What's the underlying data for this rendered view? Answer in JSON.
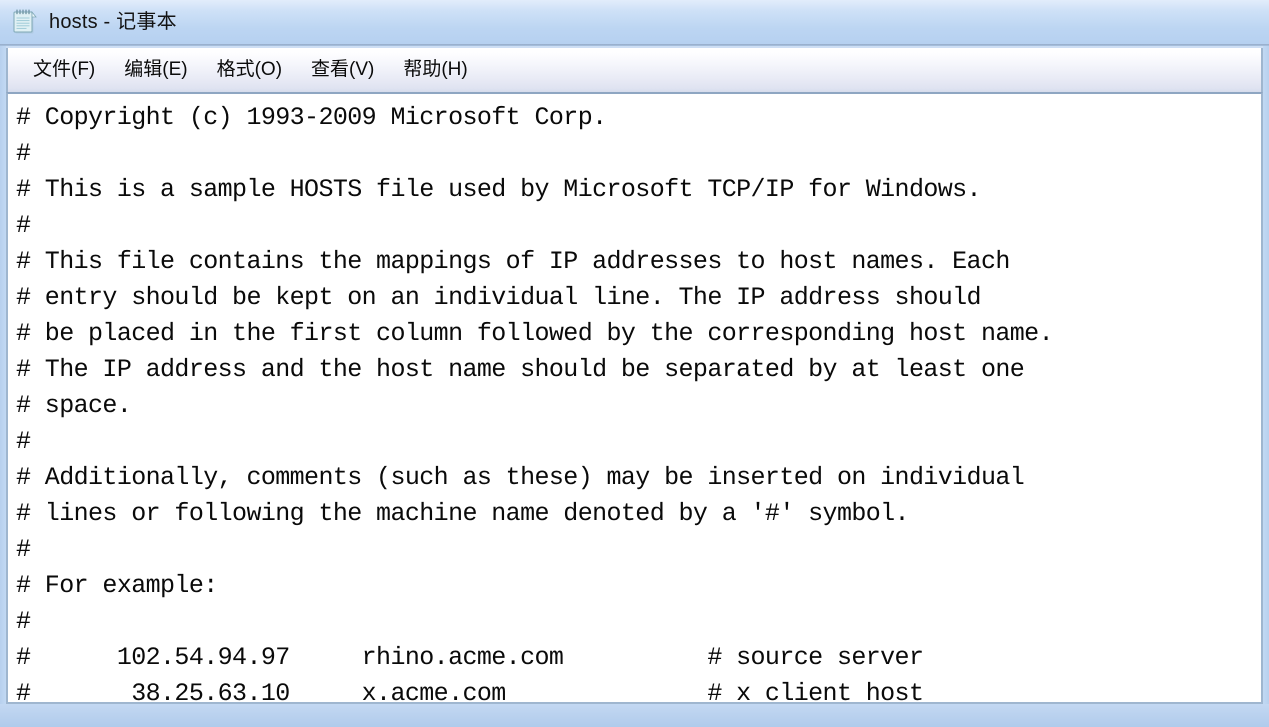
{
  "window": {
    "title": "hosts - 记事本",
    "icon": "notepad-icon",
    "frame_color": "#b8d0ee",
    "titlebar_color": "#c6dcf6"
  },
  "menubar": {
    "items": [
      {
        "id": "file",
        "label": "文件(F)"
      },
      {
        "id": "edit",
        "label": "编辑(E)"
      },
      {
        "id": "format",
        "label": "格式(O)"
      },
      {
        "id": "view",
        "label": "查看(V)"
      },
      {
        "id": "help",
        "label": "帮助(H)"
      }
    ]
  },
  "editor": {
    "content": "# Copyright (c) 1993-2009 Microsoft Corp.\n#\n# This is a sample HOSTS file used by Microsoft TCP/IP for Windows.\n#\n# This file contains the mappings of IP addresses to host names. Each\n# entry should be kept on an individual line. The IP address should\n# be placed in the first column followed by the corresponding host name.\n# The IP address and the host name should be separated by at least one\n# space.\n#\n# Additionally, comments (such as these) may be inserted on individual\n# lines or following the machine name denoted by a '#' symbol.\n#\n# For example:\n#\n#      102.54.94.97     rhino.acme.com          # source server\n#       38.25.63.10     x.acme.com              # x client host",
    "lines": [
      "# Copyright (c) 1993-2009 Microsoft Corp.",
      "#",
      "# This is a sample HOSTS file used by Microsoft TCP/IP for Windows.",
      "#",
      "# This file contains the mappings of IP addresses to host names. Each",
      "# entry should be kept on an individual line. The IP address should",
      "# be placed in the first column followed by the corresponding host name.",
      "# The IP address and the host name should be separated by at least one",
      "# space.",
      "#",
      "# Additionally, comments (such as these) may be inserted on individual",
      "# lines or following the machine name denoted by a '#' symbol.",
      "#",
      "# For example:",
      "#",
      "#      102.54.94.97     rhino.acme.com          # source server",
      "#       38.25.63.10     x.acme.com              # x client host"
    ],
    "host_entries": [
      {
        "ip": "102.54.94.97",
        "hostname": "rhino.acme.com",
        "comment": "# source server"
      },
      {
        "ip": "38.25.63.10",
        "hostname": "x.acme.com",
        "comment": "# x client host"
      }
    ]
  }
}
